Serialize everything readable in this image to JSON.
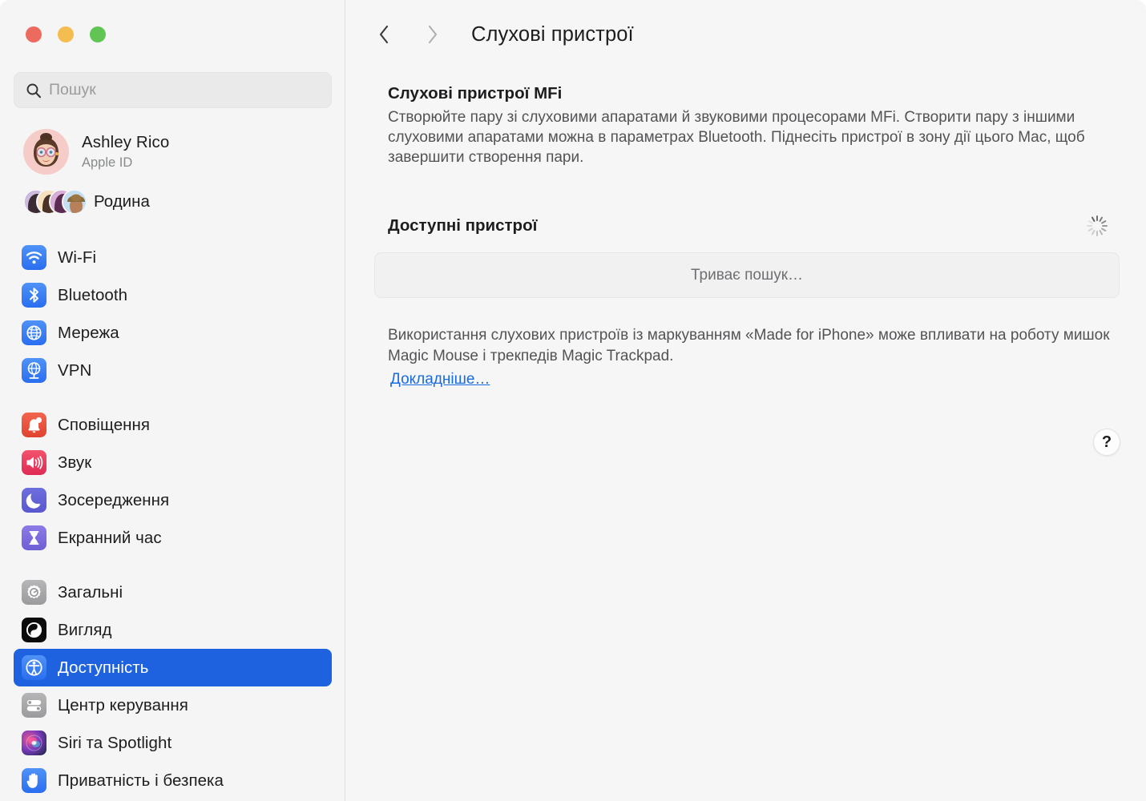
{
  "window": {
    "traffic_lights": [
      {
        "name": "close",
        "color": "#ec6a5e"
      },
      {
        "name": "minimize",
        "color": "#f4bd4f"
      },
      {
        "name": "maximize",
        "color": "#61c554"
      }
    ]
  },
  "sidebar": {
    "search": {
      "placeholder": "Пошук",
      "value": "",
      "icon": "search-icon"
    },
    "account": {
      "name": "Ashley Rico",
      "subtitle": "Apple ID"
    },
    "family": {
      "label": "Родина"
    },
    "groups": [
      {
        "id": "network",
        "items": [
          {
            "label": "Wi-Fi",
            "icon": "wifi-icon",
            "selected": false
          },
          {
            "label": "Bluetooth",
            "icon": "bluetooth-icon",
            "selected": false
          },
          {
            "label": "Мережа",
            "icon": "network-icon",
            "selected": false
          },
          {
            "label": "VPN",
            "icon": "vpn-icon",
            "selected": false
          }
        ]
      },
      {
        "id": "alerts",
        "items": [
          {
            "label": "Сповіщення",
            "icon": "bell-icon",
            "selected": false
          },
          {
            "label": "Звук",
            "icon": "speaker-icon",
            "selected": false
          },
          {
            "label": "Зосередження",
            "icon": "moon-icon",
            "selected": false
          },
          {
            "label": "Екранний час",
            "icon": "hourglass-icon",
            "selected": false
          }
        ]
      },
      {
        "id": "system",
        "items": [
          {
            "label": "Загальні",
            "icon": "gear-icon",
            "selected": false
          },
          {
            "label": "Вигляд",
            "icon": "appearance-icon",
            "selected": false
          },
          {
            "label": "Доступність",
            "icon": "accessibility-icon",
            "selected": true
          },
          {
            "label": "Центр керування",
            "icon": "control-center-icon",
            "selected": false
          },
          {
            "label": "Siri та Spotlight",
            "icon": "siri-icon",
            "selected": false
          },
          {
            "label": "Приватність і безпека",
            "icon": "hand-icon",
            "selected": false
          }
        ]
      }
    ]
  },
  "content": {
    "toolbar": {
      "back_icon": "chevron-left-icon",
      "forward_icon": "chevron-right-icon",
      "title": "Слухові пристрої"
    },
    "mfi": {
      "title": "Слухові пристрої MFi",
      "description": "Створюйте пару зі слуховими апаратами й звуковими процесорами MFi. Створити пару з іншими слуховими апаратами можна в параметрах Bluetooth. Піднесіть пристрої в зону дії цього Mac, щоб завершити створення пари."
    },
    "devices": {
      "title": "Доступні пристрої",
      "spinner_icon": "loading-spinner-icon",
      "status": "Триває пошук…"
    },
    "note": {
      "text": "Використання слухових пристроїв із маркуванням «Made for iPhone» може впливати на роботу мишок Magic Mouse і трекпедів Magic Trackpad.",
      "link": "Докладніше…"
    },
    "help": {
      "label": "?",
      "icon": "question-mark-icon"
    }
  },
  "colors": {
    "accent": "#1e62e0",
    "link": "#1a6ae0",
    "sidebar_bg": "#f5f5f5",
    "content_bg": "#f6f6f6"
  }
}
